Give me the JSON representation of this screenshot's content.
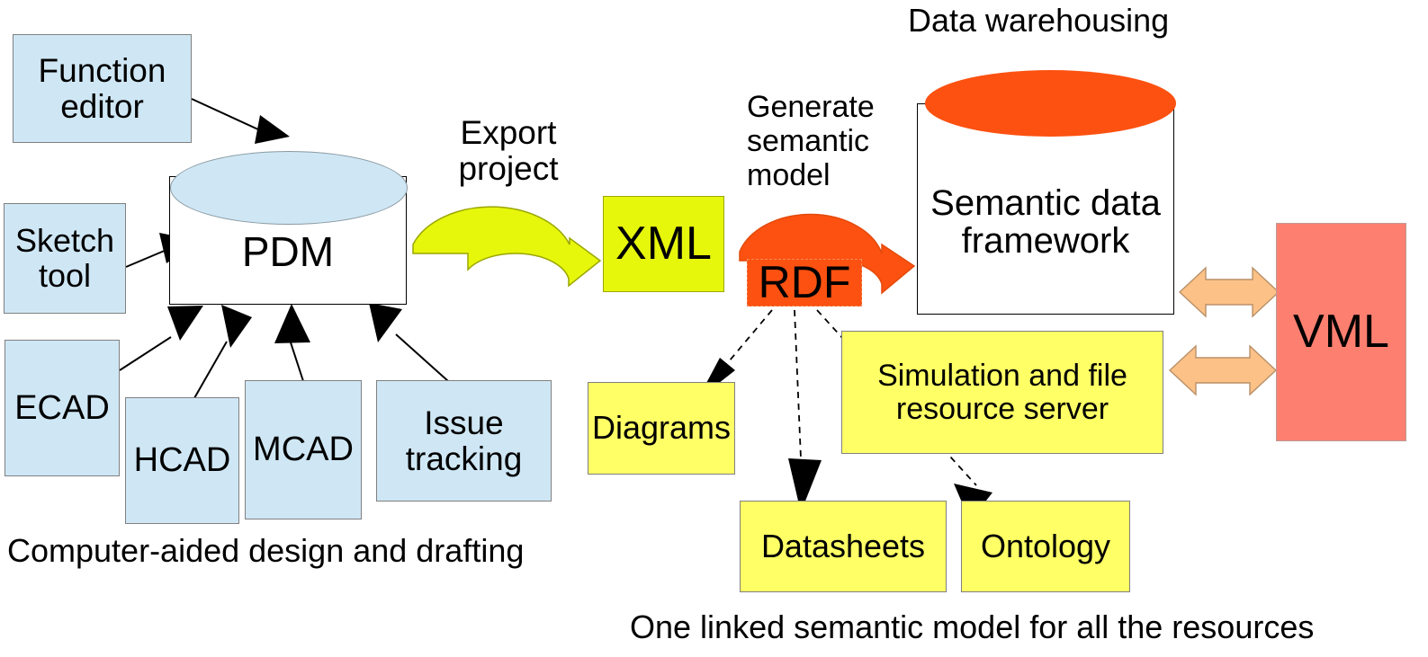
{
  "diagram": {
    "title_captions": {
      "data_warehousing": "Data warehousing",
      "cad_drafting": "Computer-aided design and drafting",
      "one_linked_model": "One linked semantic model for all the resources"
    },
    "edge_labels": {
      "export_project": "Export project",
      "generate_semantic_model": "Generate semantic model"
    },
    "source_tools": [
      {
        "id": "function-editor",
        "label": "Function editor",
        "color": "#cfe7f5"
      },
      {
        "id": "sketch-tool",
        "label": "Sketch tool",
        "color": "#cfe7f5"
      },
      {
        "id": "ecad",
        "label": "ECAD",
        "color": "#cfe7f5"
      },
      {
        "id": "hcad",
        "label": "HCAD",
        "color": "#cfe7f5"
      },
      {
        "id": "mcad",
        "label": "MCAD",
        "color": "#cfe7f5"
      },
      {
        "id": "issue-tracking",
        "label": "Issue tracking",
        "color": "#cfe7f5"
      }
    ],
    "repositories": [
      {
        "id": "pdm",
        "label": "PDM",
        "top_color": "#cfe7f5",
        "body_color": "#ffffff"
      },
      {
        "id": "semantic-data-framework",
        "label": "Semantic data framework",
        "top_color": "#fc5110",
        "body_color": "#ffffff"
      }
    ],
    "artifacts": [
      {
        "id": "xml",
        "label": "XML",
        "color": "#e6f70c"
      },
      {
        "id": "rdf",
        "label": "RDF",
        "color": "#fc5110"
      },
      {
        "id": "diagrams",
        "label": "Diagrams",
        "color": "#ffff66"
      },
      {
        "id": "datasheets",
        "label": "Datasheets",
        "color": "#ffff66"
      },
      {
        "id": "ontology",
        "label": "Ontology",
        "color": "#ffff66"
      },
      {
        "id": "simulation-server",
        "label": "Simulation and file resource server",
        "color": "#ffff66"
      },
      {
        "id": "vml",
        "label": "VML",
        "color": "#fd7f70"
      }
    ],
    "arrow_colors": {
      "export_arrow": "#e6f70c",
      "generate_arrow": "#fc5110",
      "exchange_arrow": "#fbc187",
      "solid_connector": "#000000",
      "dashed_connector": "#000000"
    }
  }
}
